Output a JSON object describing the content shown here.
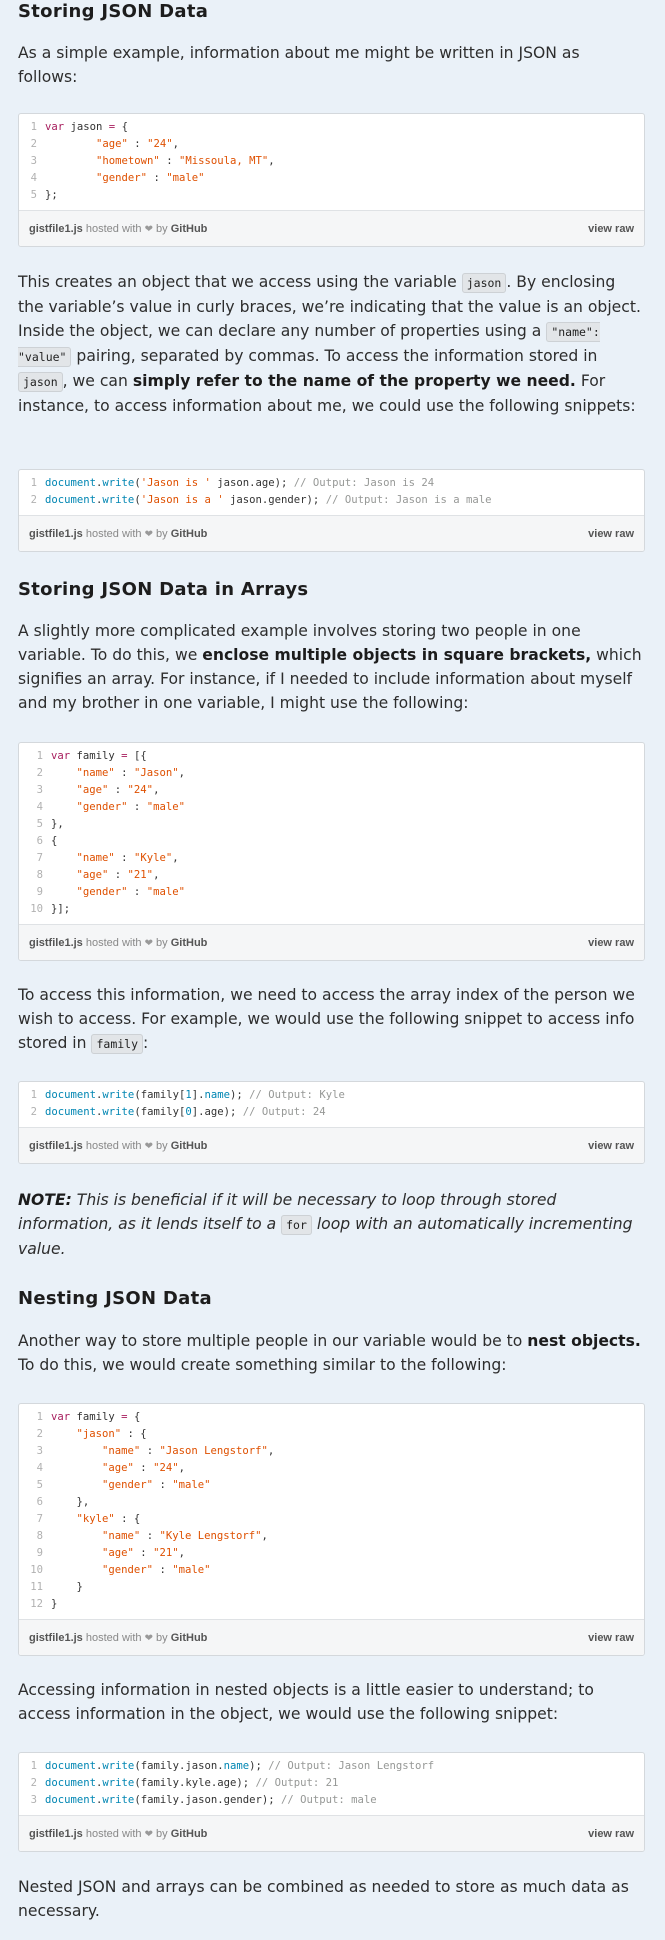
{
  "section1": {
    "heading": "Storing JSON Data",
    "intro": "As a simple example, information about me might be written in JSON as follows:"
  },
  "gist_meta": {
    "filename": "gistfile1.js",
    "hosted_with": "hosted with",
    "heart": "❤",
    "by": "by",
    "github": "GitHub",
    "view_raw": "view raw"
  },
  "gist1": {
    "lines": [
      [
        {
          "t": "var",
          "c": "kw"
        },
        {
          "t": " jason "
        },
        {
          "t": "=",
          "c": "kw"
        },
        {
          "t": " {"
        }
      ],
      [
        {
          "t": "        "
        },
        {
          "t": "\"age\"",
          "c": "str"
        },
        {
          "t": " : "
        },
        {
          "t": "\"24\"",
          "c": "str"
        },
        {
          "t": ","
        }
      ],
      [
        {
          "t": "        "
        },
        {
          "t": "\"hometown\"",
          "c": "str"
        },
        {
          "t": " : "
        },
        {
          "t": "\"Missoula, MT\"",
          "c": "str"
        },
        {
          "t": ","
        }
      ],
      [
        {
          "t": "        "
        },
        {
          "t": "\"gender\"",
          "c": "str"
        },
        {
          "t": " : "
        },
        {
          "t": "\"male\"",
          "c": "str"
        }
      ],
      [
        {
          "t": "};"
        }
      ]
    ]
  },
  "para2": {
    "t1": "This creates an object that we access using the variable ",
    "c1": "jason",
    "t2": ". By enclosing the variable’s value in curly braces, we’re indicating that the value is an object. Inside the object, we can declare any number of properties using a ",
    "c2": "\"name\": \"value\"",
    "t3": " pairing, separated by commas. To access the information stored in ",
    "c3": "jason",
    "t4": ", we can ",
    "b1": "simply refer to the name of the property we need.",
    "t5": " For instance, to access information about me, we could use the following snippets:"
  },
  "gist2": {
    "lines": [
      [
        {
          "t": "document",
          "c": "fn"
        },
        {
          "t": "."
        },
        {
          "t": "write",
          "c": "fn"
        },
        {
          "t": "("
        },
        {
          "t": "'Jason is '",
          "c": "str"
        },
        {
          "t": " jason.age); "
        },
        {
          "t": "// Output: Jason is 24",
          "c": "cm"
        }
      ],
      [
        {
          "t": "document",
          "c": "fn"
        },
        {
          "t": "."
        },
        {
          "t": "write",
          "c": "fn"
        },
        {
          "t": "("
        },
        {
          "t": "'Jason is a '",
          "c": "str"
        },
        {
          "t": " jason.gender); "
        },
        {
          "t": "// Output: Jason is a male",
          "c": "cm"
        }
      ]
    ]
  },
  "section2": {
    "heading": "Storing JSON Data in Arrays",
    "t1": "A slightly more complicated example involves storing two people in one variable. To do this, we ",
    "b1": "enclose multiple objects in square brackets,",
    "t2": " which signifies an array. For instance, if I needed to include information about myself and my brother in one variable, I might use the following:"
  },
  "gist3": {
    "lines": [
      [
        {
          "t": "var",
          "c": "kw"
        },
        {
          "t": " family "
        },
        {
          "t": "=",
          "c": "kw"
        },
        {
          "t": " [{"
        }
      ],
      [
        {
          "t": "    "
        },
        {
          "t": "\"name\"",
          "c": "str"
        },
        {
          "t": " : "
        },
        {
          "t": "\"Jason\"",
          "c": "str"
        },
        {
          "t": ","
        }
      ],
      [
        {
          "t": "    "
        },
        {
          "t": "\"age\"",
          "c": "str"
        },
        {
          "t": " : "
        },
        {
          "t": "\"24\"",
          "c": "str"
        },
        {
          "t": ","
        }
      ],
      [
        {
          "t": "    "
        },
        {
          "t": "\"gender\"",
          "c": "str"
        },
        {
          "t": " : "
        },
        {
          "t": "\"male\"",
          "c": "str"
        }
      ],
      [
        {
          "t": "},"
        }
      ],
      [
        {
          "t": "{"
        }
      ],
      [
        {
          "t": "    "
        },
        {
          "t": "\"name\"",
          "c": "str"
        },
        {
          "t": " : "
        },
        {
          "t": "\"Kyle\"",
          "c": "str"
        },
        {
          "t": ","
        }
      ],
      [
        {
          "t": "    "
        },
        {
          "t": "\"age\"",
          "c": "str"
        },
        {
          "t": " : "
        },
        {
          "t": "\"21\"",
          "c": "str"
        },
        {
          "t": ","
        }
      ],
      [
        {
          "t": "    "
        },
        {
          "t": "\"gender\"",
          "c": "str"
        },
        {
          "t": " : "
        },
        {
          "t": "\"male\"",
          "c": "str"
        }
      ],
      [
        {
          "t": "}];"
        }
      ]
    ]
  },
  "para4": {
    "t1": "To access this information, we need to access the array index of the person we wish to access. For example, we would use the following snippet to access info stored in ",
    "c1": "family",
    "t2": ":"
  },
  "gist4": {
    "lines": [
      [
        {
          "t": "document",
          "c": "fn"
        },
        {
          "t": "."
        },
        {
          "t": "write",
          "c": "fn"
        },
        {
          "t": "(family["
        },
        {
          "t": "1",
          "c": "num"
        },
        {
          "t": "]."
        },
        {
          "t": "name",
          "c": "fn"
        },
        {
          "t": "); "
        },
        {
          "t": "// Output: Kyle",
          "c": "cm"
        }
      ],
      [
        {
          "t": "document",
          "c": "fn"
        },
        {
          "t": "."
        },
        {
          "t": "write",
          "c": "fn"
        },
        {
          "t": "(family["
        },
        {
          "t": "0",
          "c": "num"
        },
        {
          "t": "].age); "
        },
        {
          "t": "// Output: 24",
          "c": "cm"
        }
      ]
    ]
  },
  "note": {
    "label": "NOTE:",
    "t1": " This is beneficial if it will be necessary to loop through stored information, as it lends itself to a ",
    "c1": "for",
    "t2": " loop with an automatically incrementing value."
  },
  "section3": {
    "heading": "Nesting JSON Data",
    "t1": "Another way to store multiple people in our variable would be to ",
    "b1": "nest objects.",
    "t2": " To do this, we would create something similar to the following:"
  },
  "gist5": {
    "lines": [
      [
        {
          "t": "var",
          "c": "kw"
        },
        {
          "t": " family "
        },
        {
          "t": "=",
          "c": "kw"
        },
        {
          "t": " {"
        }
      ],
      [
        {
          "t": "    "
        },
        {
          "t": "\"jason\"",
          "c": "str"
        },
        {
          "t": " : {"
        }
      ],
      [
        {
          "t": "        "
        },
        {
          "t": "\"name\"",
          "c": "str"
        },
        {
          "t": " : "
        },
        {
          "t": "\"Jason Lengstorf\"",
          "c": "str"
        },
        {
          "t": ","
        }
      ],
      [
        {
          "t": "        "
        },
        {
          "t": "\"age\"",
          "c": "str"
        },
        {
          "t": " : "
        },
        {
          "t": "\"24\"",
          "c": "str"
        },
        {
          "t": ","
        }
      ],
      [
        {
          "t": "        "
        },
        {
          "t": "\"gender\"",
          "c": "str"
        },
        {
          "t": " : "
        },
        {
          "t": "\"male\"",
          "c": "str"
        }
      ],
      [
        {
          "t": "    },"
        }
      ],
      [
        {
          "t": "    "
        },
        {
          "t": "\"kyle\"",
          "c": "str"
        },
        {
          "t": " : {"
        }
      ],
      [
        {
          "t": "        "
        },
        {
          "t": "\"name\"",
          "c": "str"
        },
        {
          "t": " : "
        },
        {
          "t": "\"Kyle Lengstorf\"",
          "c": "str"
        },
        {
          "t": ","
        }
      ],
      [
        {
          "t": "        "
        },
        {
          "t": "\"age\"",
          "c": "str"
        },
        {
          "t": " : "
        },
        {
          "t": "\"21\"",
          "c": "str"
        },
        {
          "t": ","
        }
      ],
      [
        {
          "t": "        "
        },
        {
          "t": "\"gender\"",
          "c": "str"
        },
        {
          "t": " : "
        },
        {
          "t": "\"male\"",
          "c": "str"
        }
      ],
      [
        {
          "t": "    }"
        }
      ],
      [
        {
          "t": "}"
        }
      ]
    ]
  },
  "para6": "Accessing information in nested objects is a little easier to understand; to access information in the object, we would use the following snippet:",
  "gist6": {
    "lines": [
      [
        {
          "t": "document",
          "c": "fn"
        },
        {
          "t": "."
        },
        {
          "t": "write",
          "c": "fn"
        },
        {
          "t": "(family.jason."
        },
        {
          "t": "name",
          "c": "fn"
        },
        {
          "t": "); "
        },
        {
          "t": "// Output: Jason Lengstorf",
          "c": "cm"
        }
      ],
      [
        {
          "t": "document",
          "c": "fn"
        },
        {
          "t": "."
        },
        {
          "t": "write",
          "c": "fn"
        },
        {
          "t": "(family.kyle.age); "
        },
        {
          "t": "// Output: 21",
          "c": "cm"
        }
      ],
      [
        {
          "t": "document",
          "c": "fn"
        },
        {
          "t": "."
        },
        {
          "t": "write",
          "c": "fn"
        },
        {
          "t": "(family.jason.gender); "
        },
        {
          "t": "// Output: male",
          "c": "cm"
        }
      ]
    ]
  },
  "para7": "Nested JSON and arrays can be combined as needed to store as much data as necessary."
}
